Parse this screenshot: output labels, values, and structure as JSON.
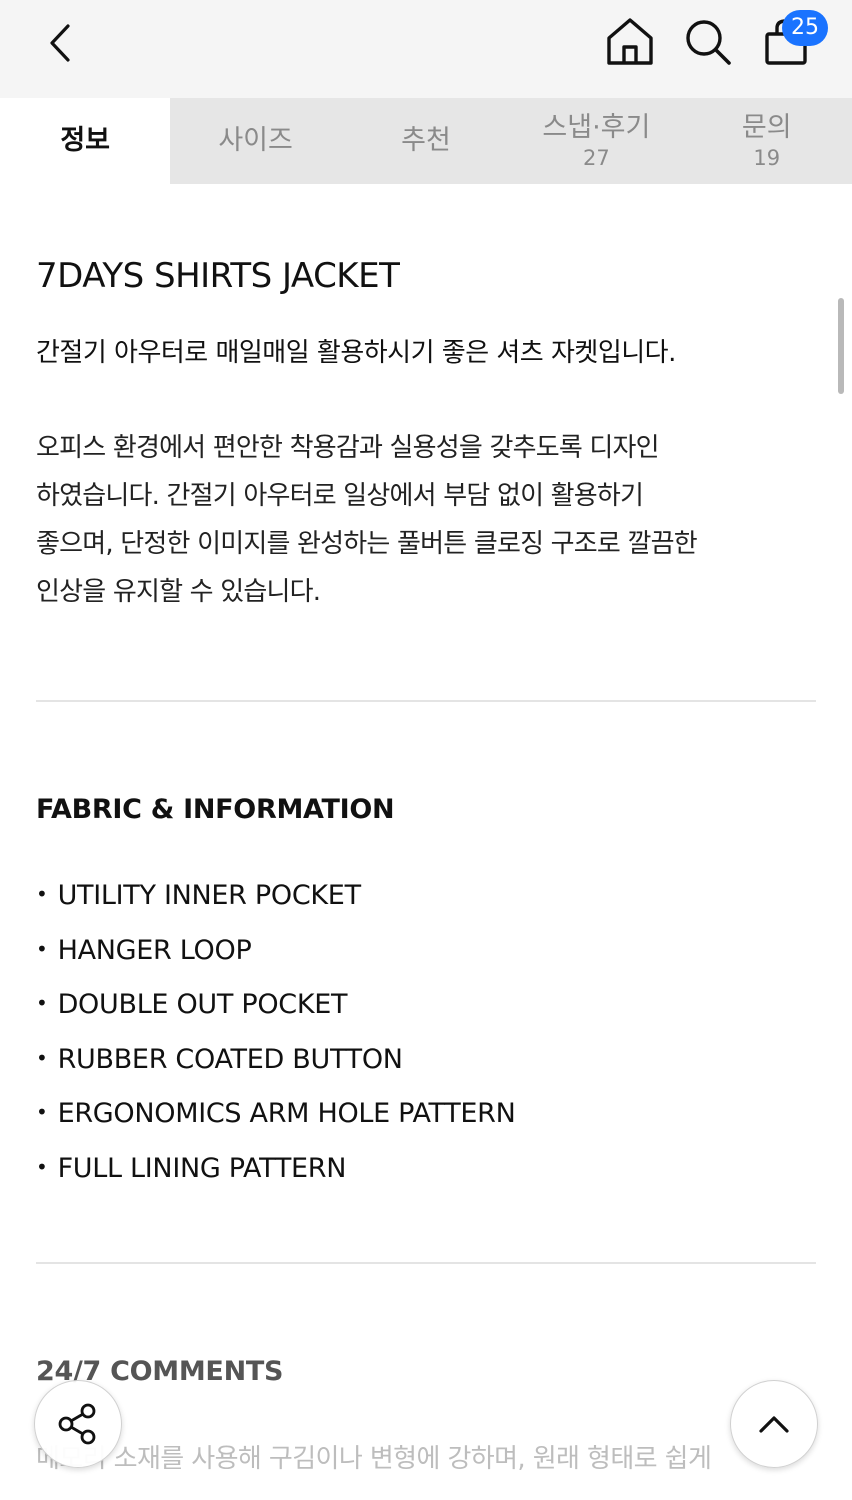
{
  "header": {
    "cart_count": "25",
    "icons": [
      "back-icon",
      "home-icon",
      "search-icon",
      "shopping-bag-icon"
    ]
  },
  "tabs": [
    {
      "label": "정보",
      "count": "",
      "active": true
    },
    {
      "label": "사이즈",
      "count": "",
      "active": false
    },
    {
      "label": "추천",
      "count": "",
      "active": false
    },
    {
      "label": "스냅·후기",
      "count": "27",
      "active": false
    },
    {
      "label": "문의",
      "count": "19",
      "active": false
    }
  ],
  "product": {
    "title": "7DAYS SHIRTS JACKET",
    "summary": "간절기 아우터로 매일매일 활용하시기 좋은 셔츠 자켓입니다.",
    "description_lines": [
      "오피스 환경에서 편안한 착용감과 실용성을 갖추도록 디자인",
      "하였습니다. 간절기 아우터로 일상에서 부담 없이 활용하기",
      "좋으며, 단정한 이미지를 완성하는 풀버튼 클로징 구조로 깔끔한",
      "인상을 유지할 수 있습니다."
    ]
  },
  "fabric": {
    "title": "FABRIC & INFORMATION",
    "items": [
      "UTILITY INNER POCKET",
      "HANGER LOOP",
      "DOUBLE OUT POCKET",
      "RUBBER COATED BUTTON",
      "ERGONOMICS ARM HOLE PATTERN",
      "FULL LINING PATTERN"
    ]
  },
  "comments": {
    "title": "24/7 COMMENTS",
    "text": "메모리 소재를 사용해 구김이나 변형에 강하며, 원래 형태로 쉽게"
  },
  "colors": {
    "topbar_bg": "#f5f5f5",
    "tabs_bg": "#e6e6e6",
    "badge": "#1a73ff"
  }
}
